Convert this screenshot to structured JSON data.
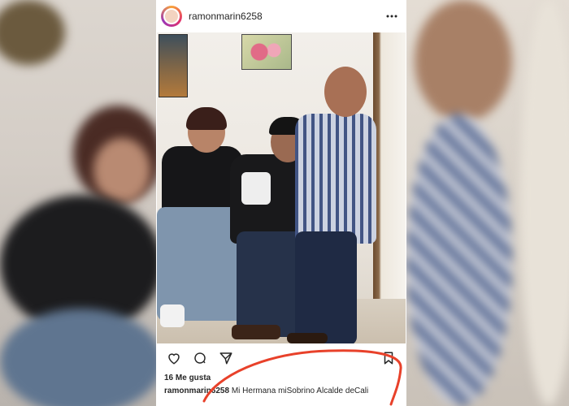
{
  "post": {
    "username": "ramonmarin6258",
    "more_icon": "more-horizontal-icon",
    "likes_count": "16",
    "likes_label": "Me gusta",
    "caption_user": "ramonmarin6258",
    "caption_text": "Mi Hermana miSobrino Alcalde deCali"
  },
  "actions": {
    "icons": [
      "heart-icon",
      "comment-icon",
      "share-icon",
      "bookmark-icon"
    ]
  },
  "colors": {
    "annotation": "#e8412a",
    "text": "#262626",
    "avatar_ring": "#e1306c"
  }
}
